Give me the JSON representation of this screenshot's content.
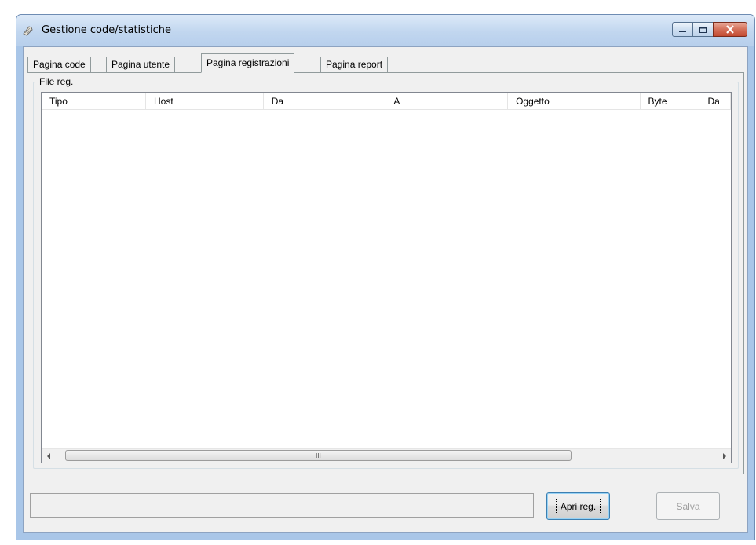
{
  "window": {
    "title": "Gestione code/statistiche"
  },
  "tabs": [
    {
      "label": "Pagina code",
      "active": false
    },
    {
      "label": "Pagina utente",
      "active": false
    },
    {
      "label": "Pagina registrazioni",
      "active": true
    },
    {
      "label": "Pagina report",
      "active": false
    }
  ],
  "group": {
    "label": "File reg."
  },
  "columns": [
    "Tipo",
    "Host",
    "Da",
    "A",
    "Oggetto",
    "Byte",
    "Da"
  ],
  "rows": [],
  "scrollbar": {
    "thumb_grip": "III"
  },
  "buttons": {
    "open": "Apri reg.",
    "save": "Salva"
  },
  "status": {
    "text": ""
  },
  "colors": {
    "titlebar": "#c1d6ef",
    "close_button": "#c24a31",
    "client_bg": "#f0f0f0"
  }
}
